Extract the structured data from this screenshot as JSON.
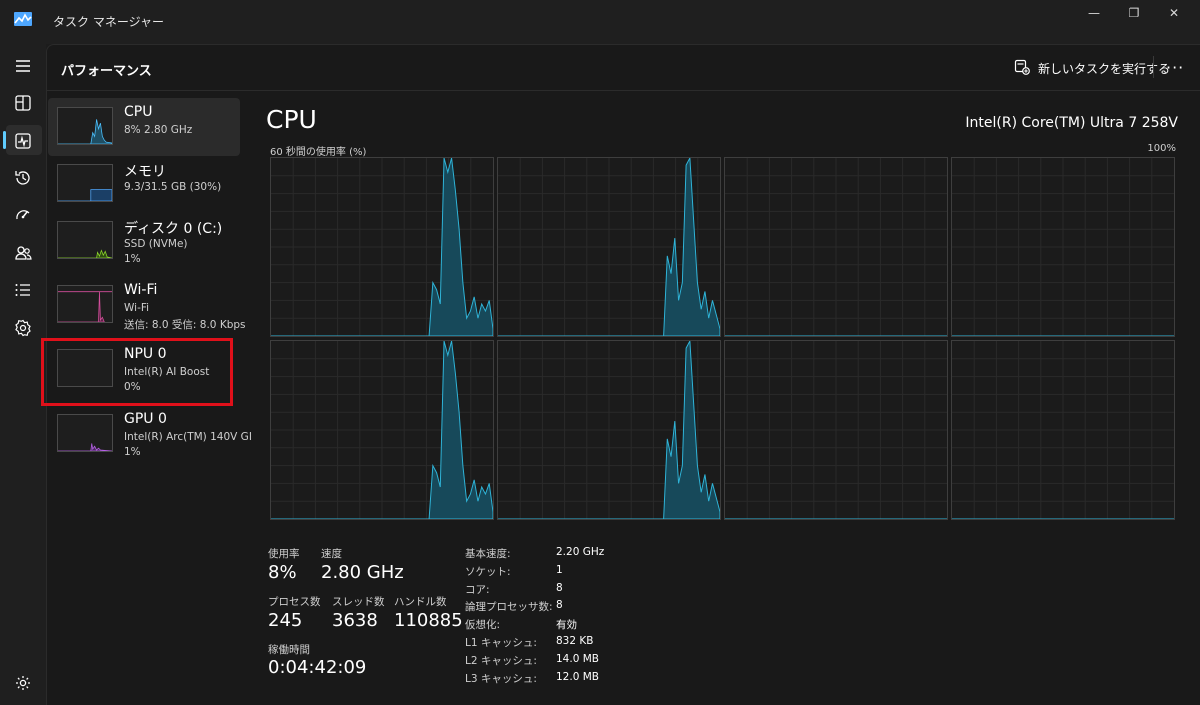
{
  "window": {
    "title": "タスク マネージャー"
  },
  "header": {
    "page_title": "パフォーマンス",
    "run_task_label": "新しいタスクを実行する",
    "more_label": "···"
  },
  "nav": [
    "menu-icon",
    "processes-icon",
    "performance-icon",
    "app-history-icon",
    "startup-apps-icon",
    "users-icon",
    "details-icon",
    "services-icon",
    "settings-icon"
  ],
  "resources": [
    {
      "name": "CPU",
      "sub1": "8%  2.80 GHz",
      "sub2": "",
      "color": "#4cc2ff"
    },
    {
      "name": "メモリ",
      "sub1": "9.3/31.5 GB (30%)",
      "sub2": "",
      "color": "#4ea7ff"
    },
    {
      "name": "ディスク 0 (C:)",
      "sub1": "SSD (NVMe)",
      "sub2": "1%",
      "color": "#8bd42a"
    },
    {
      "name": "Wi-Fi",
      "sub1": "Wi-Fi",
      "sub2": "送信: 8.0  受信: 8.0 Kbps",
      "color": "#d44f9c"
    },
    {
      "name": "NPU 0",
      "sub1": "Intel(R) AI Boost",
      "sub2": "0%",
      "color": "#8a8a8a"
    },
    {
      "name": "GPU 0",
      "sub1": "Intel(R) Arc(TM) 140V GI",
      "sub2": "1%",
      "color": "#b660e6"
    }
  ],
  "cpu": {
    "title": "CPU",
    "model": "Intel(R) Core(TM) Ultra 7 258V",
    "graph_label": "60 秒間の使用率 (%)",
    "graph_max": "100%",
    "stats": {
      "usage_label": "使用率",
      "usage": "8%",
      "speed_label": "速度",
      "speed": "2.80 GHz",
      "processes_label": "プロセス数",
      "processes": "245",
      "threads_label": "スレッド数",
      "threads": "3638",
      "handles_label": "ハンドル数",
      "handles": "110885",
      "uptime_label": "稼働時間",
      "uptime": "0:04:42:09"
    },
    "specs": [
      {
        "k": "基本速度:",
        "v": "2.20 GHz"
      },
      {
        "k": "ソケット:",
        "v": "1"
      },
      {
        "k": "コア:",
        "v": "8"
      },
      {
        "k": "論理プロセッサ数:",
        "v": "8"
      },
      {
        "k": "仮想化:",
        "v": "有効"
      },
      {
        "k": "L1 キャッシュ:",
        "v": "832 KB"
      },
      {
        "k": "L2 キャッシュ:",
        "v": "14.0 MB"
      },
      {
        "k": "L3 キャッシュ:",
        "v": "12.0 MB"
      }
    ]
  },
  "chart_data": {
    "type": "area",
    "title": "60 秒間の使用率 (%)",
    "xlabel": "",
    "ylabel": "",
    "ylim": [
      0,
      100
    ],
    "grid": true,
    "series": [
      {
        "values": [
          0,
          0,
          0,
          0,
          0,
          0,
          0,
          0,
          0,
          0,
          0,
          0,
          0,
          0,
          0,
          0,
          0,
          0,
          0,
          0,
          0,
          0,
          0,
          0,
          0,
          0,
          0,
          0,
          0,
          0,
          0,
          0,
          0,
          0,
          0,
          0,
          0,
          0,
          0,
          0,
          0,
          0,
          0,
          30,
          26,
          18,
          100,
          92,
          100,
          82,
          60,
          30,
          10,
          14,
          22,
          10,
          18,
          14,
          20,
          4
        ]
      },
      {
        "values": [
          0,
          0,
          0,
          0,
          0,
          0,
          0,
          0,
          0,
          0,
          0,
          0,
          0,
          0,
          0,
          0,
          0,
          0,
          0,
          0,
          0,
          0,
          0,
          0,
          0,
          0,
          0,
          0,
          0,
          0,
          0,
          0,
          0,
          0,
          0,
          0,
          0,
          0,
          0,
          0,
          0,
          0,
          0,
          0,
          0,
          45,
          35,
          55,
          20,
          30,
          96,
          100,
          65,
          30,
          15,
          25,
          10,
          20,
          12,
          4
        ]
      },
      {
        "values": [
          0,
          0,
          0,
          0,
          0,
          0,
          0,
          0,
          0,
          0,
          0,
          0,
          0,
          0,
          0,
          0,
          0,
          0,
          0,
          0,
          0,
          0,
          0,
          0,
          0,
          0,
          0,
          0,
          0,
          0,
          0,
          0,
          0,
          0,
          0,
          0,
          0,
          0,
          0,
          0,
          0,
          0,
          0,
          0,
          0,
          0,
          0,
          0,
          0,
          0,
          0,
          0,
          0,
          0,
          0,
          0,
          0,
          0,
          0,
          0,
          0,
          0,
          0,
          0,
          0,
          0,
          0,
          0,
          0,
          0,
          0,
          0,
          0,
          0,
          0,
          0,
          0,
          0,
          0,
          0,
          0,
          0,
          0,
          0
        ]
      },
      {
        "values": [
          0,
          0,
          0,
          0,
          0,
          0,
          0,
          0,
          0,
          0,
          0,
          0,
          0,
          0,
          0,
          0,
          0,
          0,
          0,
          0,
          0,
          0,
          0,
          0,
          0,
          0,
          0,
          0,
          0,
          0,
          0,
          0,
          0,
          0,
          0,
          0,
          0,
          0,
          0,
          0,
          0,
          0,
          0,
          0,
          0,
          0,
          0,
          0,
          0,
          0,
          0,
          0,
          0,
          0,
          0,
          0,
          0,
          0,
          0,
          0
        ]
      }
    ]
  }
}
